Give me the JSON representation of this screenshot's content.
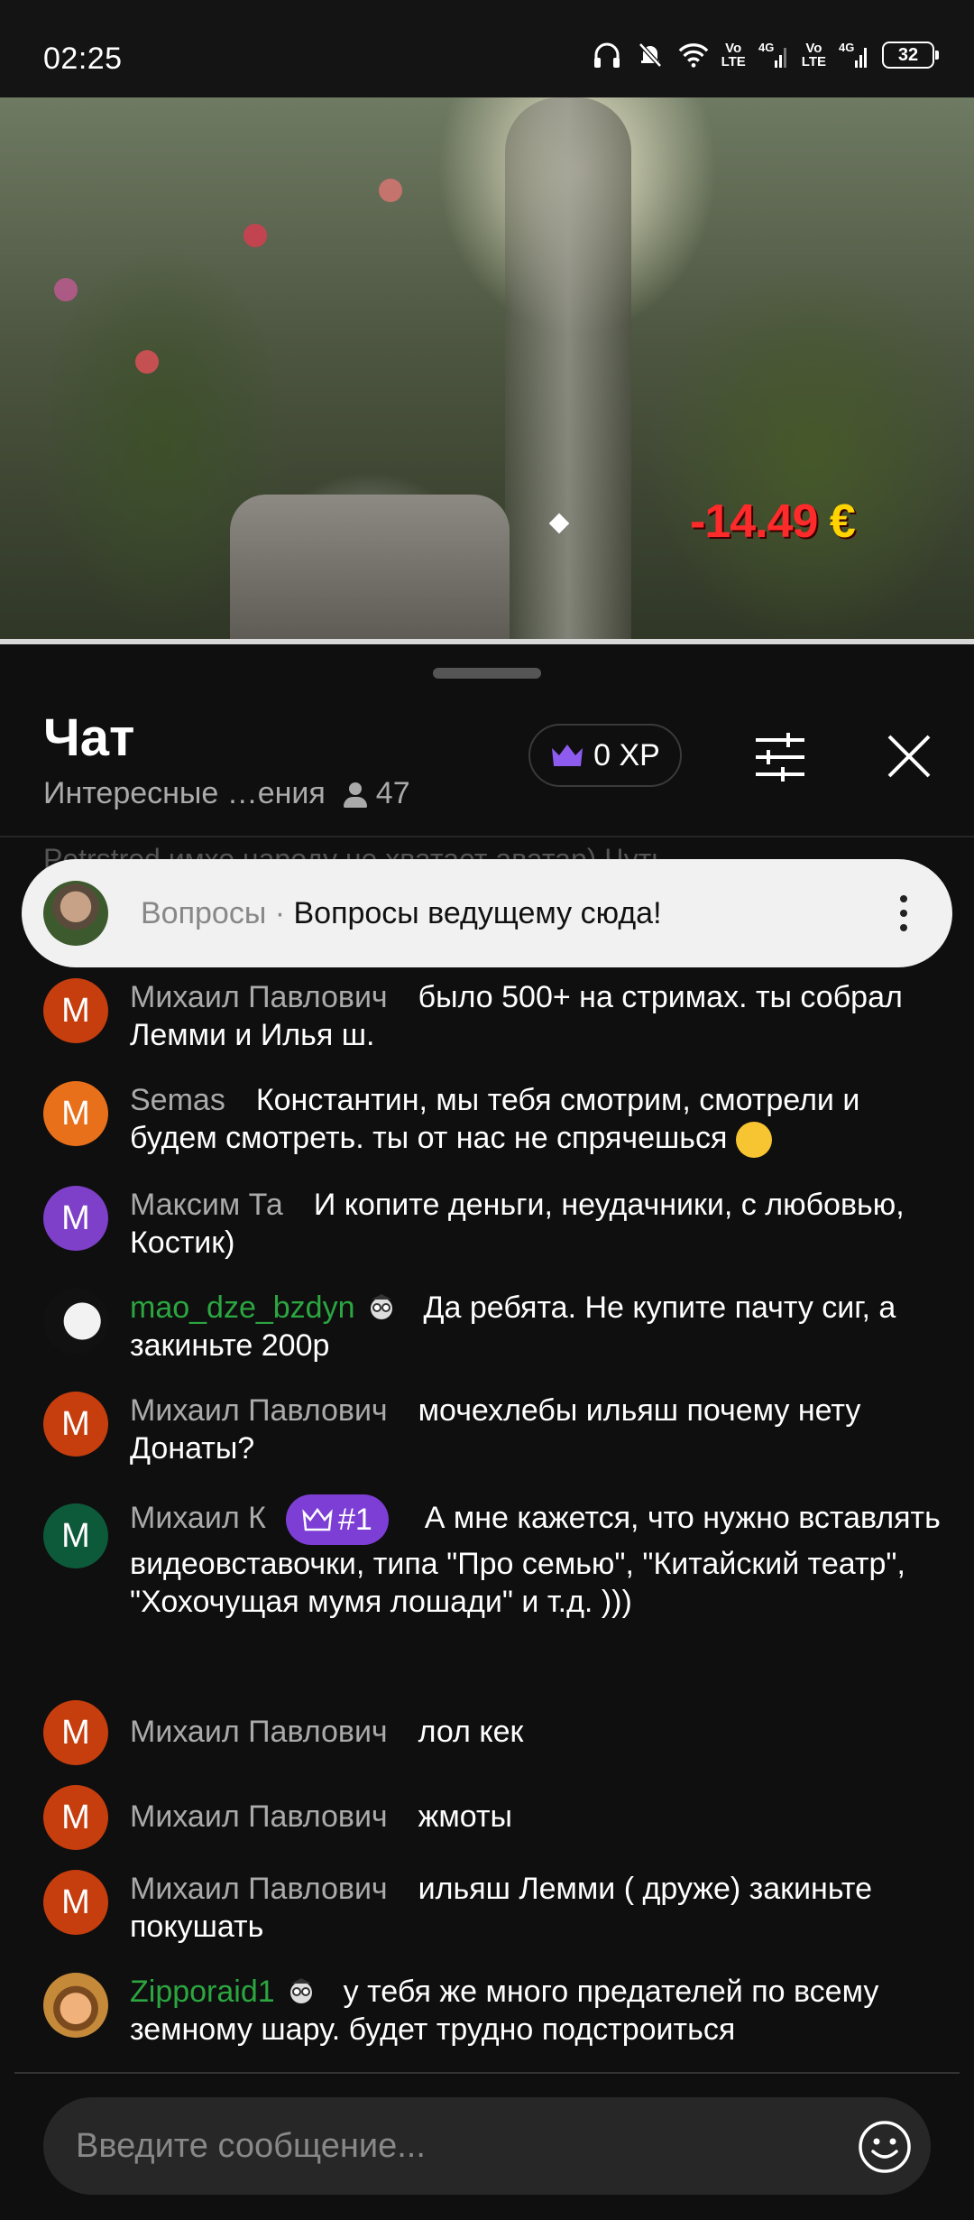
{
  "status_bar": {
    "time": "02:25",
    "net1": "Vo\nLTE",
    "net2": "4G",
    "net3": "Vo\nLTE",
    "net4": "4G",
    "battery": "32"
  },
  "video": {
    "overlay_price": "-14.49",
    "overlay_currency": "€"
  },
  "chat": {
    "title": "Чат",
    "subtitle": "Интересные …ения",
    "viewers": "47",
    "xp": "0 XP",
    "ghost_text": "Petrstred имхо народу не хватает аватар) Чуть"
  },
  "pinned": {
    "label": "Вопросы",
    "separator": " · ",
    "text": "Вопросы ведущему сюда!"
  },
  "messages": [
    {
      "initial": "М",
      "author": "Михаил Павлович",
      "text": "было 500+ на стримах. ты собрал Лемми и Илья ш.",
      "avatar_color": "#c63e0e"
    },
    {
      "initial": "M",
      "author": "Semas",
      "text": "Константин, мы тебя смотрим, смотрели и будем смотреть. ты от нас не спрячешься",
      "avatar_color": "#e8701a"
    },
    {
      "initial": "М",
      "author": "Максим Та",
      "text": "И копите деньги, неудачники, с любовью, Костик)",
      "avatar_color": "#7e3fc9"
    },
    {
      "initial": "",
      "author": "mao_dze_bzdyn",
      "text": "Да ребята. Не купите пачту сиг, а закиньте 200р",
      "avatar_color": "#111111"
    },
    {
      "initial": "М",
      "author": "Михаил Павлович",
      "text": "мочехлебы ильяш почему нету Донаты?",
      "avatar_color": "#c63e0e"
    },
    {
      "initial": "М",
      "author": "Михаил К",
      "badge": "#1",
      "text": "А мне кажется, что нужно вставлять видеовставочки, типа \"Про семью\", \"Китайский театр\", \"Хохочущая мумя лошади\" и т.д. )))",
      "avatar_color": "#0d5a3a"
    },
    {
      "initial": "М",
      "author": "Михаил Павлович",
      "text": "лол кек",
      "avatar_color": "#c63e0e"
    },
    {
      "initial": "М",
      "author": "Михаил Павлович",
      "text": "жмоты",
      "avatar_color": "#c63e0e"
    },
    {
      "initial": "М",
      "author": "Михаил Павлович",
      "text": "ильяш Лемми ( друже) закиньте покушать",
      "avatar_color": "#c63e0e"
    },
    {
      "initial": "",
      "author": "Zipporaid1",
      "text": "у тебя же много предателей по всему земному шару. будет трудно подстроиться",
      "avatar_color": "#c48a3a"
    }
  ],
  "composer": {
    "placeholder": "Введите сообщение..."
  }
}
